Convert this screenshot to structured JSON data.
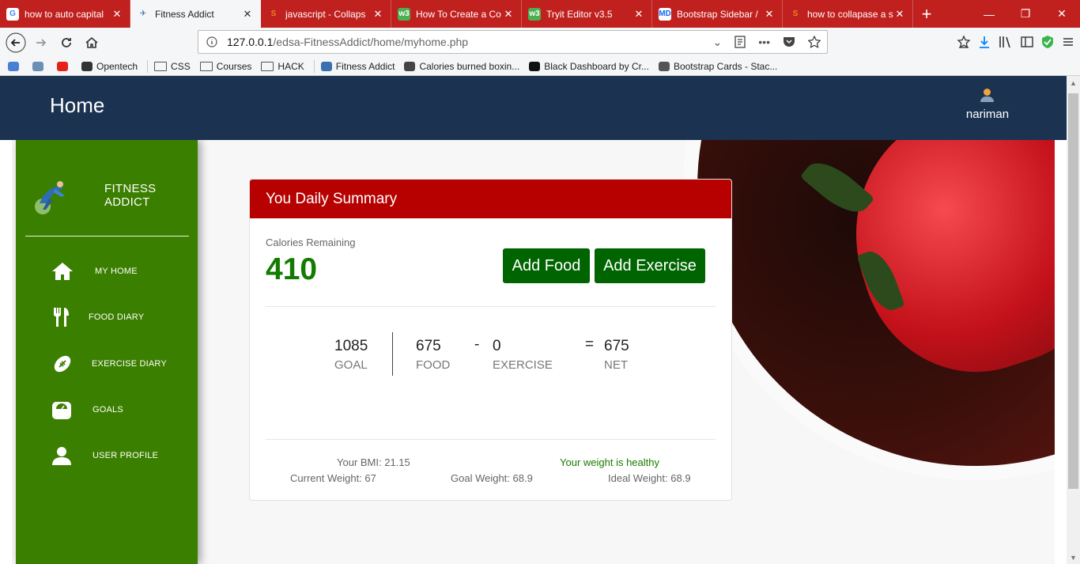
{
  "browser": {
    "tabs": [
      {
        "title": "how to auto capital",
        "icon": "G",
        "icon_bg": "#ffffff",
        "icon_color": "#4285f4",
        "active": false
      },
      {
        "title": "Fitness Addict",
        "icon": "✈",
        "icon_bg": "#f5f6f7",
        "icon_color": "#3a6fb0",
        "active": true
      },
      {
        "title": "javascript - Collaps",
        "icon": "S",
        "icon_bg": "#c0201e",
        "icon_color": "#f48024",
        "active": false
      },
      {
        "title": "How To Create a Co",
        "icon": "w3",
        "icon_bg": "#4caf50",
        "icon_color": "#ffffff",
        "active": false
      },
      {
        "title": "Tryit Editor v3.5",
        "icon": "w3",
        "icon_bg": "#4caf50",
        "icon_color": "#ffffff",
        "active": false
      },
      {
        "title": "Bootstrap Sidebar /",
        "icon": "MD",
        "icon_bg": "#ffffff",
        "icon_color": "#1266f1",
        "active": false
      },
      {
        "title": "how to collapase a s",
        "icon": "S",
        "icon_bg": "#c0201e",
        "icon_color": "#f48024",
        "active": false
      }
    ],
    "new_tab": "+",
    "window_controls": {
      "minimize": "—",
      "restore": "❐",
      "close": "✕"
    },
    "url_host": "127.0.0.1",
    "url_path": "/edsa-FitnessAddict/home/myhome.php",
    "url_more": "•••",
    "bookmarks": [
      {
        "label": "",
        "type": "icon",
        "color": "#4a7fd6"
      },
      {
        "label": "",
        "type": "icon",
        "color": "#6b8fb5"
      },
      {
        "label": "",
        "type": "icon",
        "color": "#e62117"
      },
      {
        "label": "Opentech",
        "type": "link",
        "color": "#333333"
      },
      {
        "label": "CSS",
        "type": "folder"
      },
      {
        "label": "Courses",
        "type": "folder"
      },
      {
        "label": "HACK",
        "type": "folder"
      },
      {
        "label": "Fitness Addict",
        "type": "link",
        "color": "#3a6fb0"
      },
      {
        "label": "Calories burned boxin...",
        "type": "link",
        "color": "#444444"
      },
      {
        "label": "Black Dashboard by Cr...",
        "type": "link",
        "color": "#111111"
      },
      {
        "label": "Bootstrap Cards - Stac...",
        "type": "link",
        "color": "#555555"
      }
    ]
  },
  "header": {
    "title": "Home",
    "user_name": "nariman"
  },
  "sidebar": {
    "brand": "FITNESS ADDICT",
    "items": [
      {
        "label": "MY HOME",
        "icon": "home-icon"
      },
      {
        "label": "FOOD DIARY",
        "icon": "utensils-icon"
      },
      {
        "label": "EXERCISE DIARY",
        "icon": "football-icon"
      },
      {
        "label": "GOALS",
        "icon": "scale-icon"
      },
      {
        "label": "USER PROFILE",
        "icon": "user-icon"
      }
    ]
  },
  "summary": {
    "title": "You Daily Summary",
    "calories_label": "Calories Remaining",
    "calories_value": "410",
    "add_food": "Add Food",
    "add_exercise": "Add Exercise",
    "goal_value": "1085",
    "goal_label": "GOAL",
    "food_value": "675",
    "food_label": "FOOD",
    "minus": "-",
    "exercise_value": "0",
    "exercise_label": "EXERCISE",
    "equals": "=",
    "net_value": "675",
    "net_label": "NET",
    "bmi": "Your BMI: 21.15",
    "weight_status": "Your weight is healthy",
    "current_weight": "Current Weight: 67",
    "goal_weight": "Goal Weight: 68.9",
    "ideal_weight": "Ideal Weight: 68.9"
  },
  "colors": {
    "header_bg": "#1b3350",
    "sidebar_bg": "#3b7f00",
    "card_header": "#b70000",
    "button_bg": "#006400",
    "calories_color": "#127b00",
    "tabbar_bg": "#c0201e"
  }
}
